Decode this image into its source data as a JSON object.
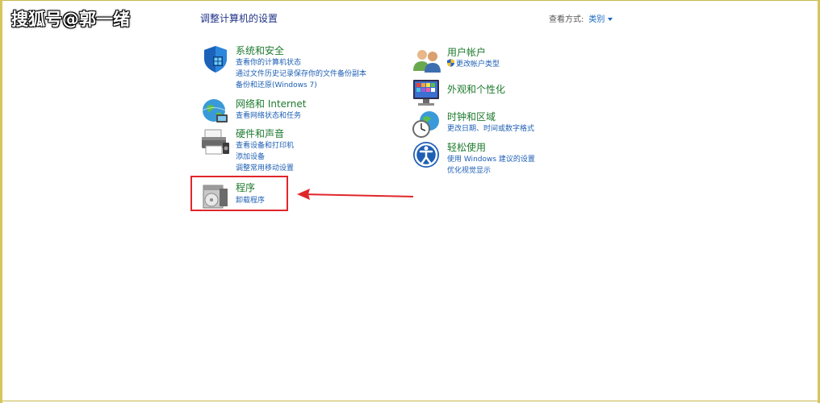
{
  "watermark": "搜狐号@郭一绪",
  "page_title": "调整计算机的设置",
  "view_by": {
    "label": "查看方式:",
    "value": "类别"
  },
  "categories": {
    "security": {
      "title": "系统和安全",
      "links": [
        "查看你的计算机状态",
        "通过文件历史记录保存你的文件备份副本",
        "备份和还原(Windows 7)"
      ]
    },
    "network": {
      "title": "网络和 Internet",
      "links": [
        "查看网络状态和任务"
      ]
    },
    "hardware": {
      "title": "硬件和声音",
      "links": [
        "查看设备和打印机",
        "添加设备",
        "调整常用移动设置"
      ]
    },
    "programs": {
      "title": "程序",
      "links": [
        "卸载程序"
      ]
    },
    "accounts": {
      "title": "用户帐户",
      "links": [
        "更改帐户类型"
      ]
    },
    "appearance": {
      "title": "外观和个性化",
      "links": []
    },
    "clock": {
      "title": "时钟和区域",
      "links": [
        "更改日期、时间或数字格式"
      ]
    },
    "ease": {
      "title": "轻松使用",
      "links": [
        "使用 Windows 建议的设置",
        "优化视觉显示"
      ]
    }
  },
  "colors": {
    "category_title": "#1e7a2e",
    "link": "#1e5fb4",
    "highlight": "#e0262a"
  },
  "icons": [
    "shield-icon",
    "network-globe-icon",
    "printer-icon",
    "programs-disc-icon",
    "users-icon",
    "monitor-palette-icon",
    "clock-globe-icon",
    "ease-of-access-icon",
    "uac-shield-icon"
  ]
}
